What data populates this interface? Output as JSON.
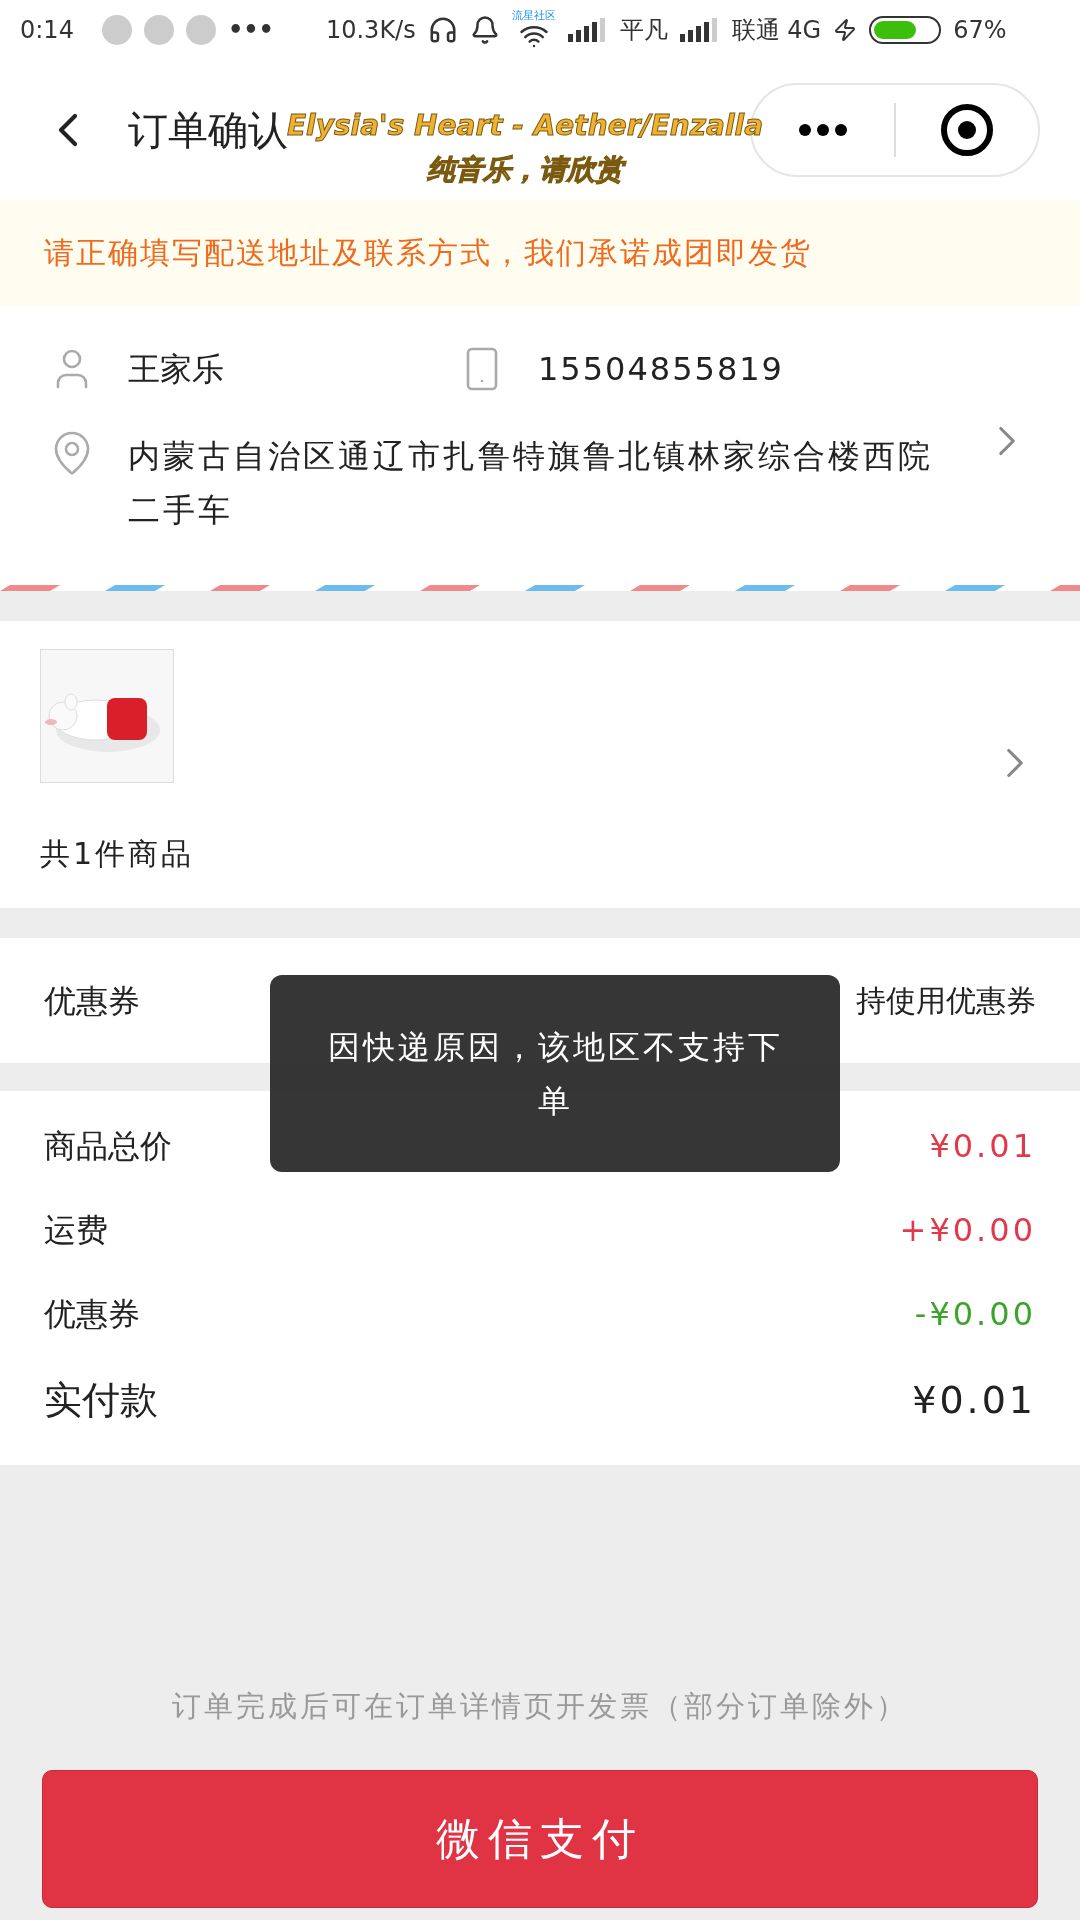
{
  "status_bar": {
    "time": "0:14",
    "more": "•••",
    "speed": "10.3K/s",
    "wifi_label": "流星社区",
    "carrier_1": "平凡",
    "carrier_2": "联通 4G",
    "battery": {
      "level": 0.67,
      "reading": "67%"
    }
  },
  "nav": {
    "title": "订单确认"
  },
  "lyric_overlay": {
    "lines": [
      "Elysia's Heart - Aether/Enzalla",
      "纯音乐，请欣赏"
    ]
  },
  "notice": "请正确填写配送地址及联系方式，我们承诺成团即发货",
  "address": {
    "name": "王家乐",
    "phone": "15504855819",
    "address": "内蒙古自治区通辽市扎鲁特旗鲁北镇林家综合楼西院二手车"
  },
  "products": {
    "count": "共1件商品"
  },
  "coupon": {
    "label": "优惠券",
    "value": "持使用优惠券"
  },
  "toast": "因快递原因，该地区不支持下单",
  "summary": [
    {
      "label": "商品总价",
      "value": "¥0.01",
      "color": "#e2394a"
    },
    {
      "label": "运费",
      "value": "+¥0.00",
      "color": "#e2394a"
    },
    {
      "label": "优惠券",
      "value": "-¥0.00",
      "color": "#3aa52a"
    }
  ],
  "total": {
    "label": "实付款",
    "value": "¥0.01"
  },
  "invoice_note": "订单完成后可在订单详情页开发票（部分订单除外）",
  "pay_button": "微信支付"
}
